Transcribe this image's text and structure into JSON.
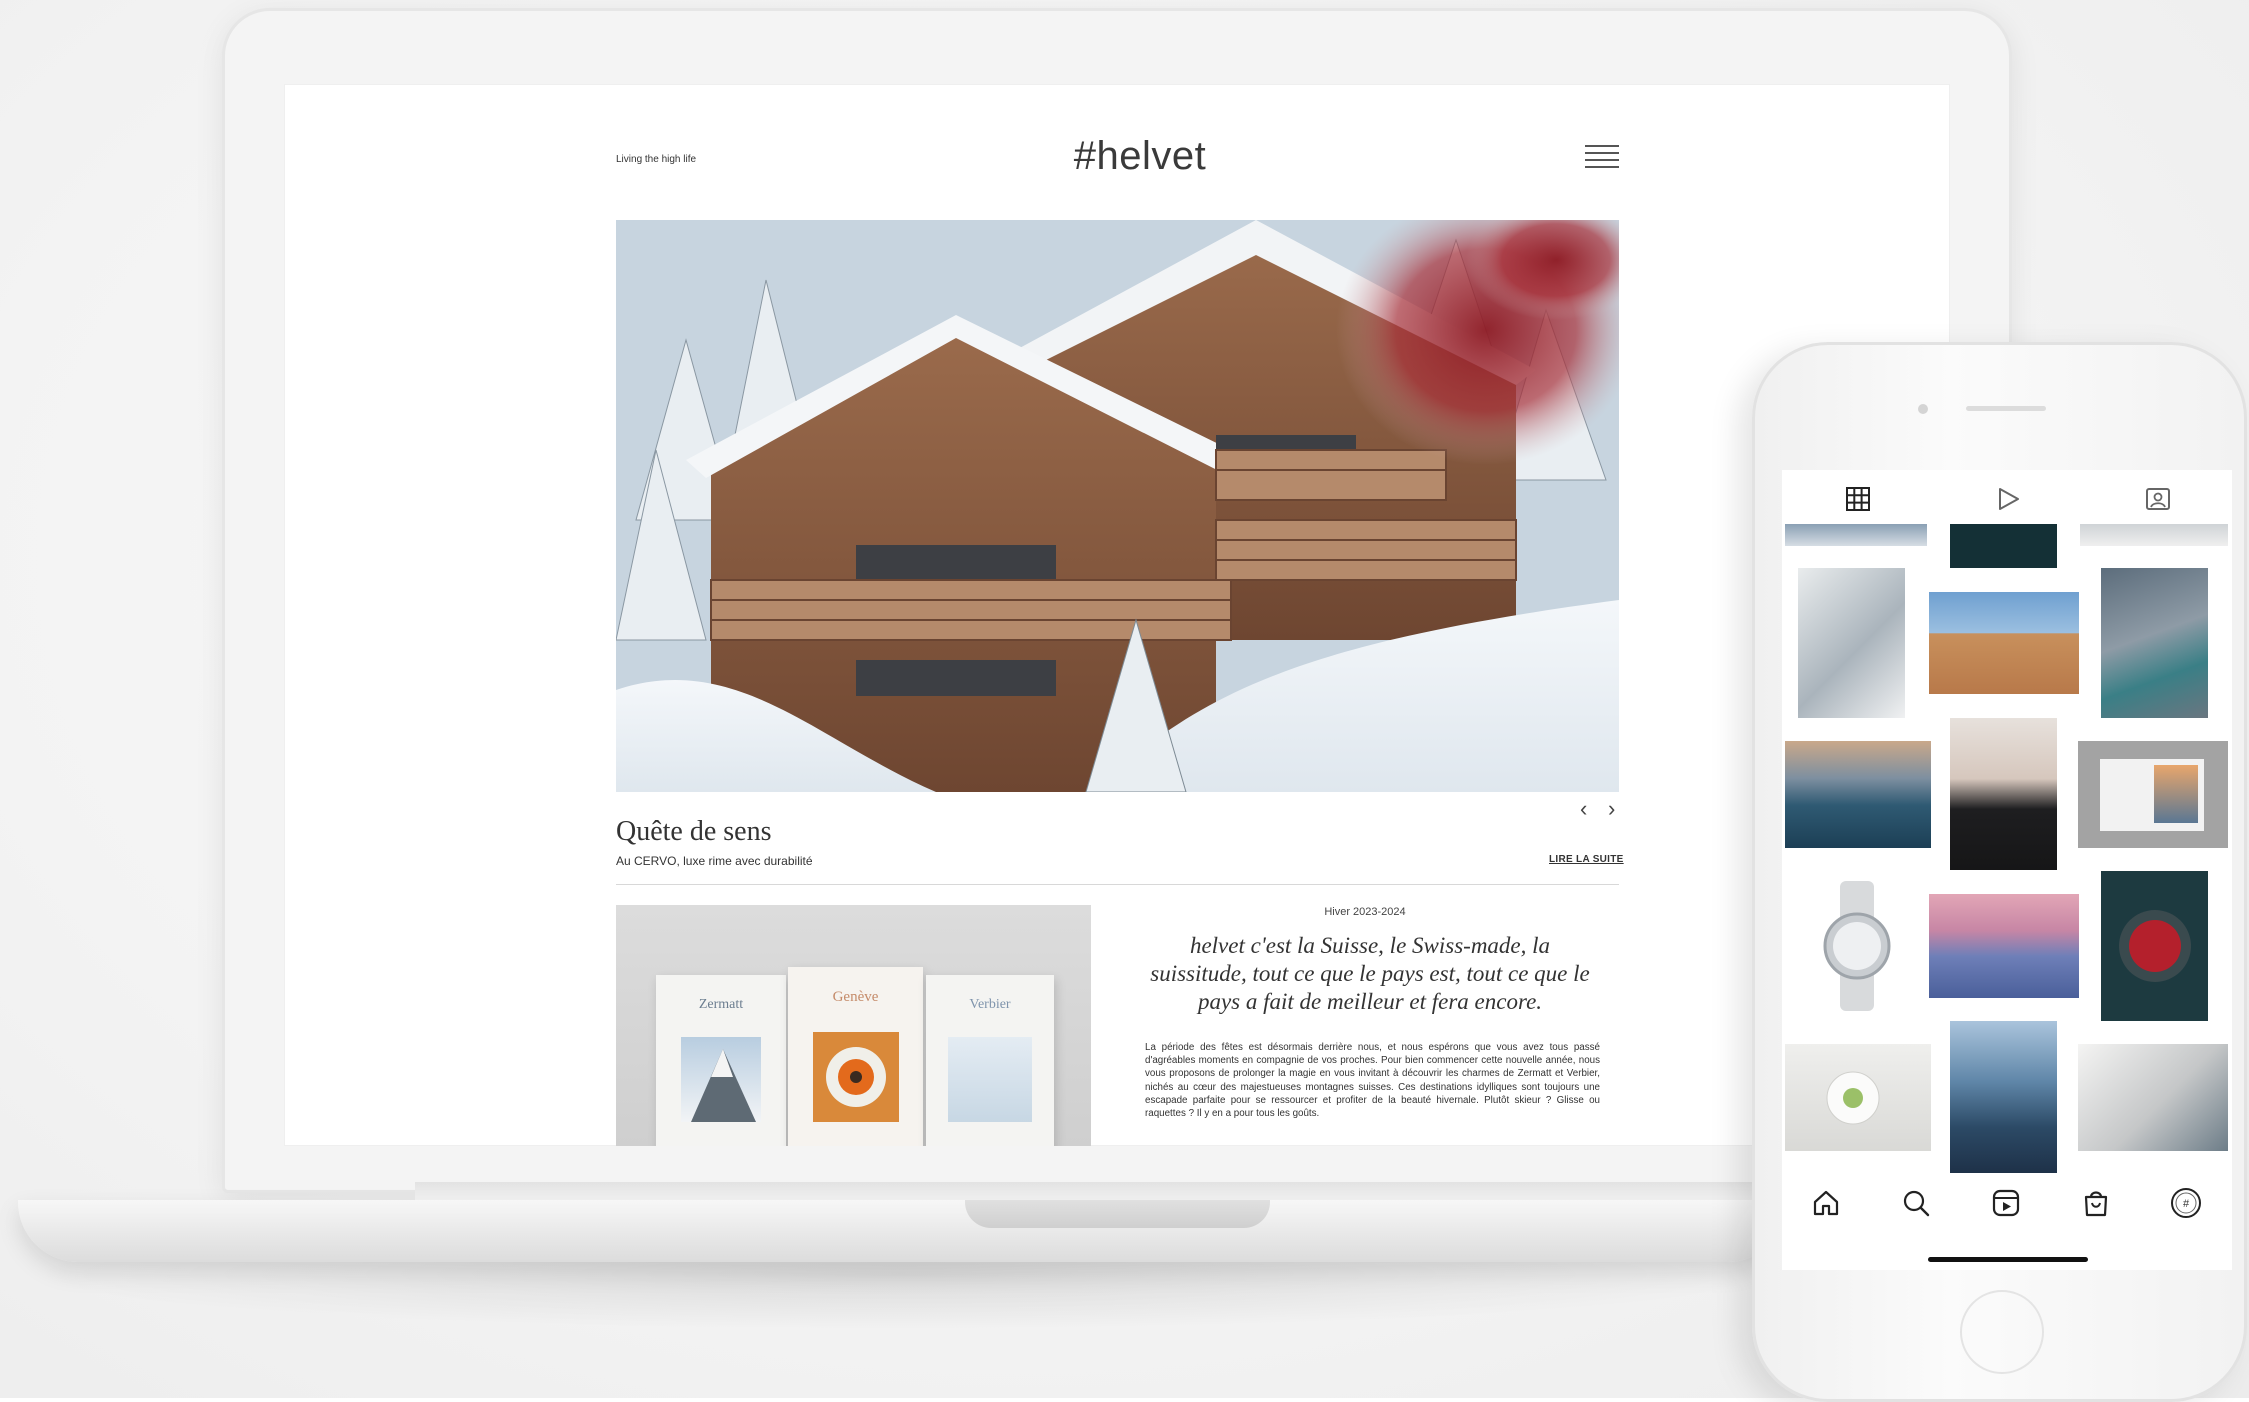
{
  "site": {
    "tagline": "Living the high life",
    "logo": "#helvet",
    "article": {
      "title": "Quête de sens",
      "subtitle": "Au CERVO, luxe rime avec durabilité",
      "read_more": "LIRE LA SUITE",
      "prev": "‹",
      "next": "›"
    },
    "magazines": [
      "Zermatt",
      "Genève",
      "Verbier"
    ],
    "edition": {
      "season": "Hiver 2023-2024",
      "quote": "helvet c'est la Suisse, le Swiss-made, la suissitude, tout ce que le pays est, tout ce que le pays a fait de meilleur et fera encore.",
      "body": "La période des fêtes est désormais derrière nous, et nous espérons que vous avez tous passé d'agréables moments en compagnie de vos proches. Pour bien commencer cette nouvelle année, nous vous proposons de prolonger la magie en vous invitant à découvrir les charmes de Zermatt et Verbier, nichés au cœur des majestueuses montagnes suisses. Ces destinations idylliques sont toujours une escapade parfaite pour se ressourcer et profiter de la beauté hivernale. Plutôt skieur ? Glisse ou raquettes ? Il y en a pour tous les goûts."
    }
  },
  "phone": {
    "tabs": [
      {
        "icon": "grid-icon"
      },
      {
        "icon": "reels-play-icon"
      },
      {
        "icon": "tagged-icon"
      }
    ],
    "nav": [
      {
        "icon": "home-icon"
      },
      {
        "icon": "search-icon"
      },
      {
        "icon": "reels-icon"
      },
      {
        "icon": "shop-icon"
      },
      {
        "icon": "profile-avatar-icon"
      }
    ],
    "grid_tiles": [
      "glacier-ice",
      "opera-house",
      "mountain-lake",
      "mountain-sunset",
      "woman-portrait",
      "magazine-spread",
      "luxury-watch",
      "alpenglow-peaks",
      "red-dish",
      "gourmet-plate",
      "matterhorn-reflection",
      "book-pages"
    ]
  },
  "colors": {
    "accent_red": "#8e1b24",
    "text": "#333333",
    "logo": "#3a3a3a"
  }
}
